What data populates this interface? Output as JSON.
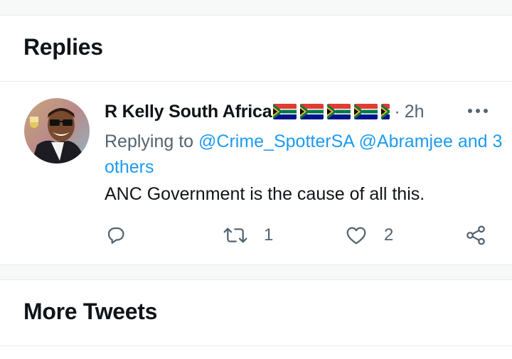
{
  "sections": {
    "replies_title": "Replies",
    "more_tweets_title": "More Tweets"
  },
  "tweet": {
    "author_name": "R Kelly South Africa",
    "flag_emoji": "south-africa-flag",
    "flag_count": 5,
    "separator": "·",
    "time": "2h",
    "reply_prefix": "Replying to",
    "mention_1": "@Crime_SpotterSA",
    "mention_2": "@Abramjee",
    "mention_3": "and 3 others",
    "text": "ANC Government is the cause of all this.",
    "reply_count": "",
    "retweet_count": "1",
    "like_count": "2"
  },
  "icons": {
    "more": "more-horizontal-icon",
    "reply": "reply-icon",
    "retweet": "retweet-icon",
    "like": "heart-icon",
    "share": "share-icon"
  },
  "colors": {
    "link": "#1d9bf0",
    "secondary": "#536471",
    "primary_text": "#0f1419",
    "divider": "#e6ecf0"
  }
}
